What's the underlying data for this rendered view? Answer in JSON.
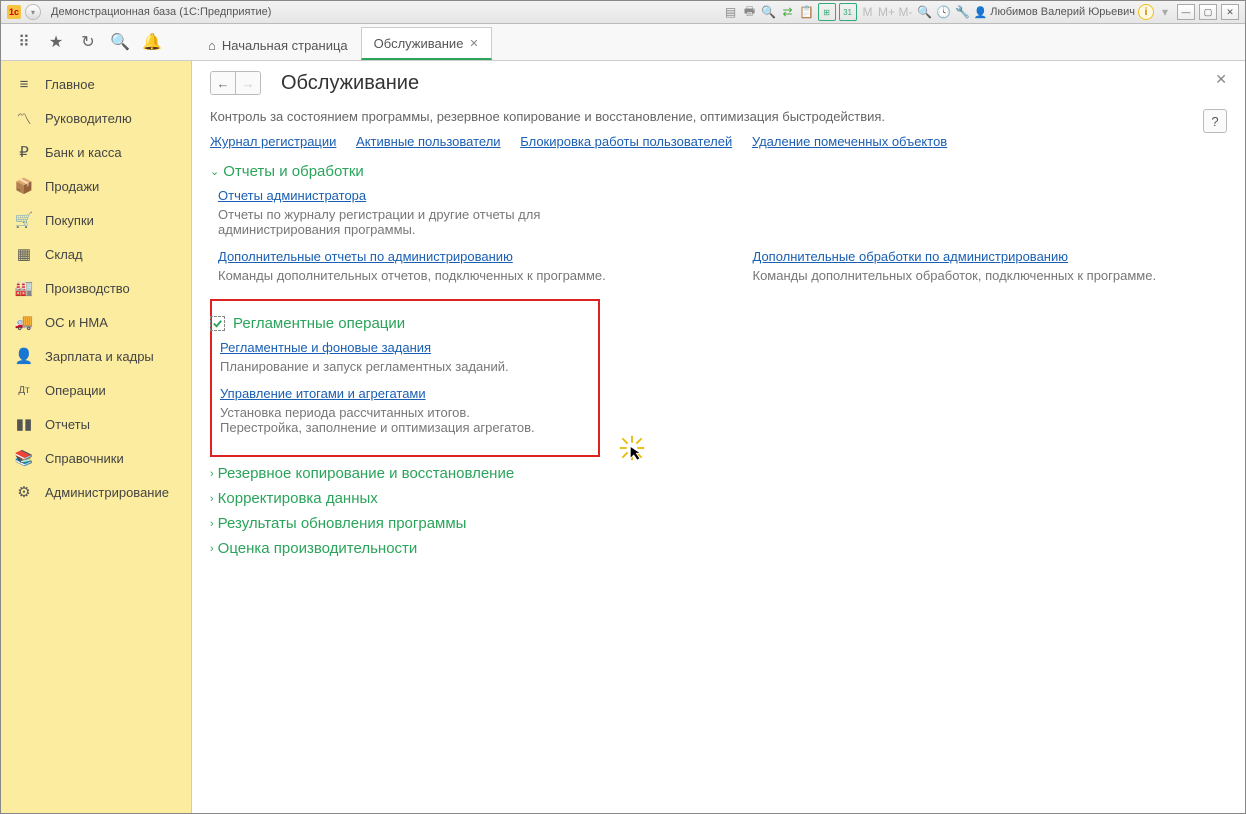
{
  "titlebar": {
    "app_title": "Демонстрационная база  (1С:Предприятие)",
    "user_name": "Любимов Валерий Юрьевич"
  },
  "tabs": {
    "home": "Начальная страница",
    "active": "Обслуживание"
  },
  "sidebar": {
    "items": [
      {
        "icon": "≡",
        "label": "Главное"
      },
      {
        "icon": "〽",
        "label": "Руководителю"
      },
      {
        "icon": "₽",
        "label": "Банк и касса"
      },
      {
        "icon": "📦",
        "label": "Продажи"
      },
      {
        "icon": "🛒",
        "label": "Покупки"
      },
      {
        "icon": "▦",
        "label": "Склад"
      },
      {
        "icon": "🏭",
        "label": "Производство"
      },
      {
        "icon": "🚚",
        "label": "ОС и НМА"
      },
      {
        "icon": "👤",
        "label": "Зарплата и кадры"
      },
      {
        "icon": "Дт",
        "label": "Операции"
      },
      {
        "icon": "▮▮",
        "label": "Отчеты"
      },
      {
        "icon": "📚",
        "label": "Справочники"
      },
      {
        "icon": "⚙",
        "label": "Администрирование"
      }
    ]
  },
  "content": {
    "heading": "Обслуживание",
    "description": "Контроль за состоянием программы, резервное копирование и восстановление, оптимизация быстродействия.",
    "toplinks": [
      "Журнал регистрации",
      "Активные пользователи",
      "Блокировка работы пользователей",
      "Удаление помеченных объектов"
    ],
    "section1": {
      "title": "Отчеты и обработки",
      "link1": "Отчеты администратора",
      "desc1": "Отчеты по журналу регистрации и другие отчеты для администрирования программы.",
      "link2": "Дополнительные отчеты по администрированию",
      "desc2": "Команды дополнительных отчетов, подключенных к программе.",
      "link3": "Дополнительные обработки по администрированию",
      "desc3": "Команды дополнительных обработок, подключенных к программе."
    },
    "section2": {
      "title": "Регламентные операции",
      "link1": "Регламентные и фоновые задания",
      "desc1": "Планирование и запуск регламентных заданий.",
      "link2": "Управление итогами и агрегатами",
      "desc2": "Установка периода рассчитанных итогов. Перестройка, заполнение и оптимизация агрегатов."
    },
    "section3": "Резервное копирование и восстановление",
    "section4": "Корректировка данных",
    "section5": "Результаты обновления программы",
    "section6": "Оценка производительности"
  }
}
